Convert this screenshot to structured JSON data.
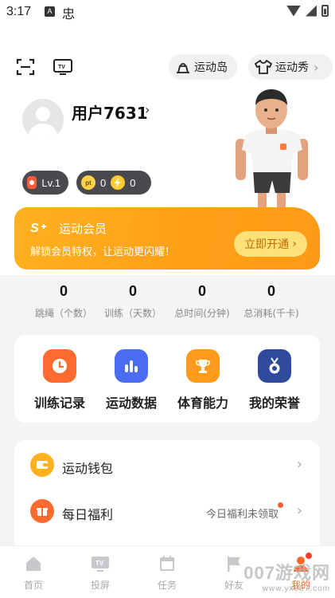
{
  "status_bar": {
    "time": "3:17",
    "a_icon": "A",
    "bug_icon": "忠"
  },
  "header": {
    "island_label": "运动岛",
    "show_label": "运动秀"
  },
  "profile": {
    "username": "用户7631",
    "level": "Lv.1",
    "points": "0",
    "energy": "0"
  },
  "vip": {
    "title": "运动会员",
    "desc": "解锁会员特权，让运动更闪耀！",
    "button": "立即开通"
  },
  "stats": [
    {
      "value": "0",
      "label": "跳绳（个数）"
    },
    {
      "value": "0",
      "label": "训练（天数）"
    },
    {
      "value": "0",
      "label": "总时间(分钟)"
    },
    {
      "value": "0",
      "label": "总消耗(千卡)"
    }
  ],
  "shortcuts": [
    {
      "label": "训练记录"
    },
    {
      "label": "运动数据"
    },
    {
      "label": "体育能力"
    },
    {
      "label": "我的荣誉"
    }
  ],
  "list": [
    {
      "label": "运动钱包",
      "status": ""
    },
    {
      "label": "每日福利",
      "status": "今日福利未领取"
    }
  ],
  "nav": [
    {
      "label": "首页"
    },
    {
      "label": "投屏"
    },
    {
      "label": "任务"
    },
    {
      "label": "好友"
    },
    {
      "label": "我的"
    }
  ],
  "watermark": {
    "main": "007游戏网",
    "sub": "www.yx007.com"
  },
  "colors": {
    "accent": "#ff6a2a",
    "vip_orange": "#ffa018",
    "shortcut_orange": "#ff6b2f",
    "shortcut_blue": "#4a6cf0",
    "shortcut_amber": "#ff9a1a",
    "shortcut_navy": "#2f4a9c"
  }
}
